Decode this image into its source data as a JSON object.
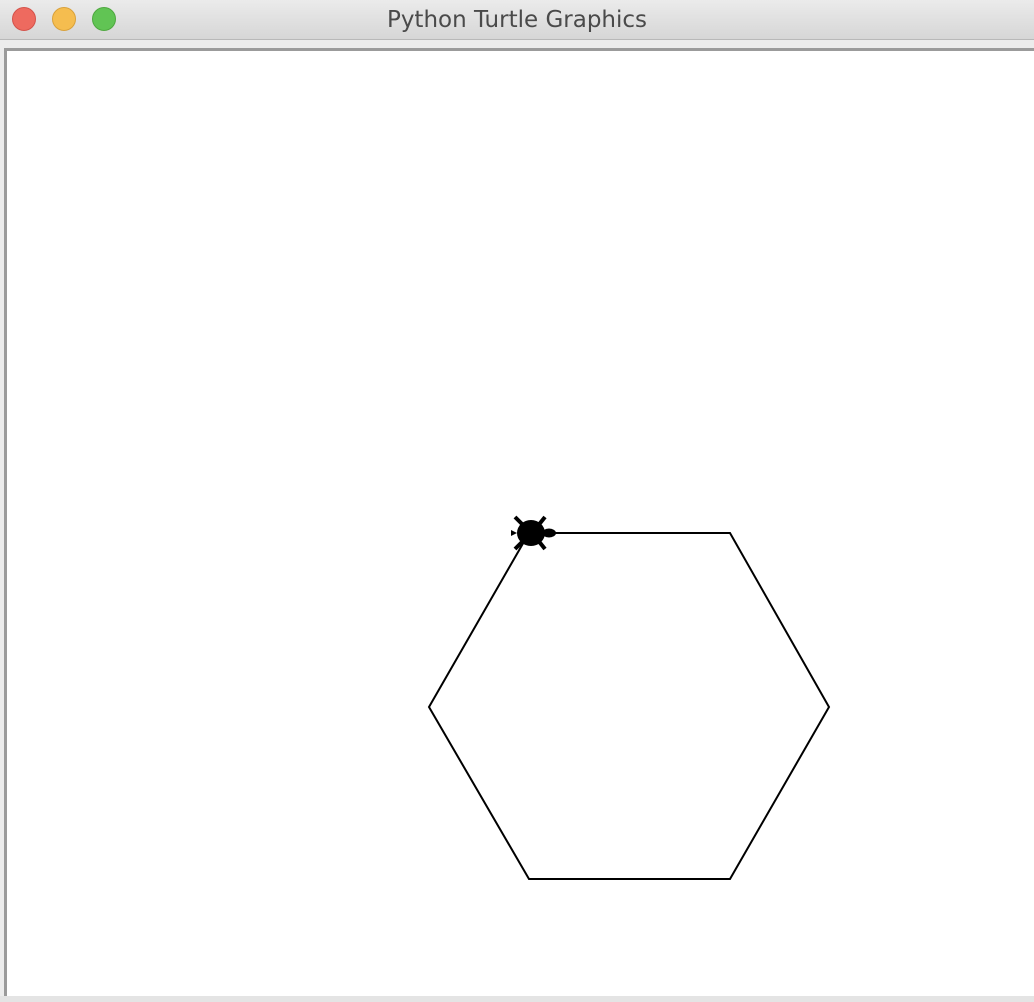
{
  "window": {
    "title": "Python Turtle Graphics",
    "buttons": {
      "close": "close",
      "minimize": "minimize",
      "zoom": "zoom"
    }
  },
  "canvas": {
    "background": "#ffffff",
    "stroke_color": "#000000",
    "turtle_color": "#000000",
    "turtle_icon": "turtle-icon"
  }
}
